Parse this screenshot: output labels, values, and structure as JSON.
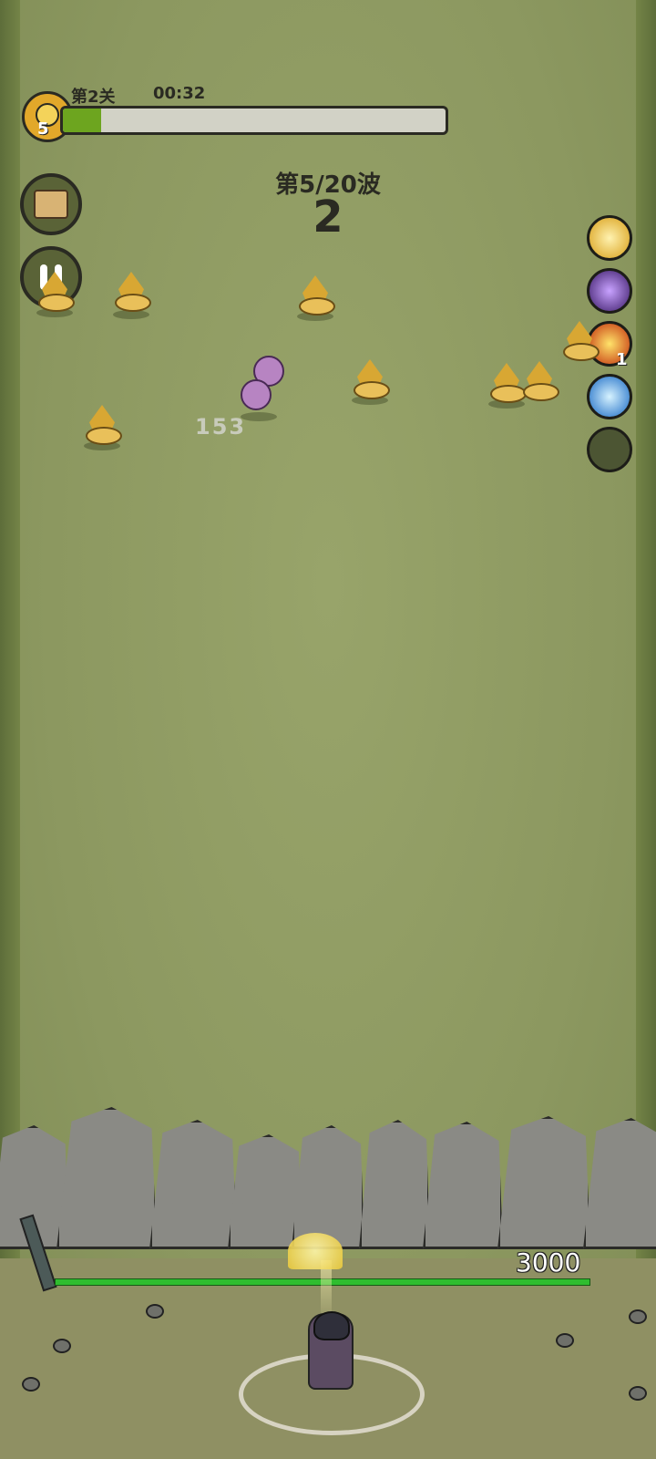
{
  "hud": {
    "level_badge_number": "5",
    "stage_label": "第2关",
    "timer": "00:32",
    "progress_fraction": 0.1
  },
  "wave": {
    "label": "第5/20波",
    "count": "2"
  },
  "skills": [
    {
      "name": "wing-skill-icon"
    },
    {
      "name": "dark-orb-skill-icon"
    },
    {
      "name": "fire-skill-icon",
      "badge": "1"
    },
    {
      "name": "water-skill-icon"
    },
    {
      "name": "empty-skill-slot"
    }
  ],
  "combat": {
    "damage_number": "153",
    "wall_hp": "3000"
  },
  "colors": {
    "grass": "#8e9a62",
    "progress_fill": "#6da51f",
    "hp_bar": "#2fbd2f"
  }
}
